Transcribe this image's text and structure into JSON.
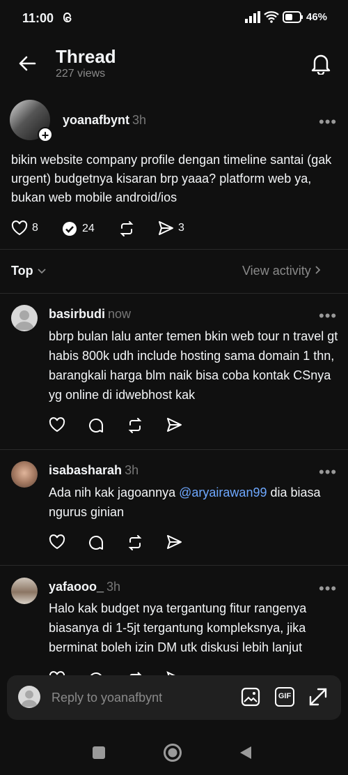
{
  "status": {
    "time": "11:00",
    "battery": "46%"
  },
  "header": {
    "title": "Thread",
    "views": "227 views"
  },
  "post": {
    "username": "yoanafbynt",
    "time": "3h",
    "text": "bikin website company profile dengan timeline santai (gak urgent) budgetnya kisaran brp yaaa? platform web ya, bukan web mobile android/ios",
    "likes": "8",
    "replies": "24",
    "shares": "3"
  },
  "sort": {
    "label": "Top",
    "view_activity": "View activity"
  },
  "replies": [
    {
      "username": "basirbudi",
      "time": "now",
      "text": "bbrp bulan lalu anter temen bkin web tour n travel gt habis 800k udh include hosting sama domain 1 thn, barangkali harga blm naik bisa coba kontak CSnya yg online di idwebhost kak"
    },
    {
      "username": "isabasharah",
      "time": "3h",
      "text_before": "Ada nih kak jagoannya ",
      "mention": "@aryairawan99",
      "text_after": " dia biasa ngurus ginian"
    },
    {
      "username": "yafaooo_",
      "time": "3h",
      "text": "Halo kak budget nya tergantung fitur rangenya biasanya di 1-5jt tergantung kompleksnya, jika berminat boleh izin DM utk diskusi lebih lanjut"
    }
  ],
  "composer": {
    "placeholder": "Reply to yoanafbynt"
  },
  "icons": [
    "threads-icon",
    "signal-icon",
    "wifi-icon",
    "battery-icon",
    "back-arrow-icon",
    "bell-icon",
    "heart-icon",
    "comment-icon",
    "repost-icon",
    "send-icon",
    "image-icon",
    "gif-icon",
    "expand-icon",
    "stop-icon",
    "home-icon",
    "back-nav-icon"
  ],
  "colors": {
    "background": "#101010",
    "text": "#f3f5f7",
    "muted": "#8a8a8a",
    "mention": "#6ea8ff"
  }
}
